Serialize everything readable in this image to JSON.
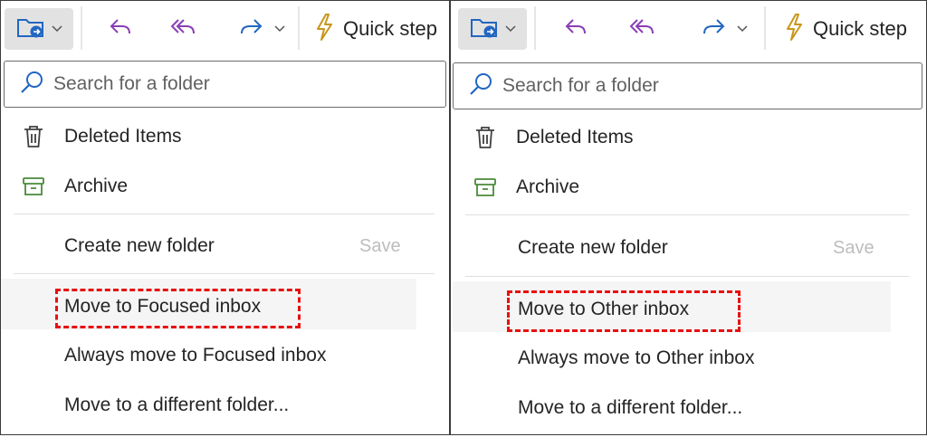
{
  "panels": [
    {
      "toolbar": {
        "quick_steps_label": "Quick step"
      },
      "search": {
        "placeholder": "Search for a folder"
      },
      "folders": [
        {
          "label": "Deleted Items",
          "icon": "trash-icon"
        },
        {
          "label": "Archive",
          "icon": "archive-icon"
        }
      ],
      "create_folder": {
        "label": "Create new folder",
        "save_label": "Save"
      },
      "actions": [
        "Move to Focused inbox",
        "Always move to Focused inbox",
        "Move to a different folder..."
      ]
    },
    {
      "toolbar": {
        "quick_steps_label": "Quick step"
      },
      "search": {
        "placeholder": "Search for a folder"
      },
      "folders": [
        {
          "label": "Deleted Items",
          "icon": "trash-icon"
        },
        {
          "label": "Archive",
          "icon": "archive-icon"
        }
      ],
      "create_folder": {
        "label": "Create new folder",
        "save_label": "Save"
      },
      "actions": [
        "Move to Other inbox",
        "Always move to Other inbox",
        "Move to a different folder..."
      ]
    }
  ],
  "colors": {
    "accent_blue": "#2266c2",
    "undo_purple": "#8a3fb5",
    "lightning_yellow": "#c9961a",
    "archive_green": "#4a8a3a",
    "highlight_red": "#e81010"
  }
}
